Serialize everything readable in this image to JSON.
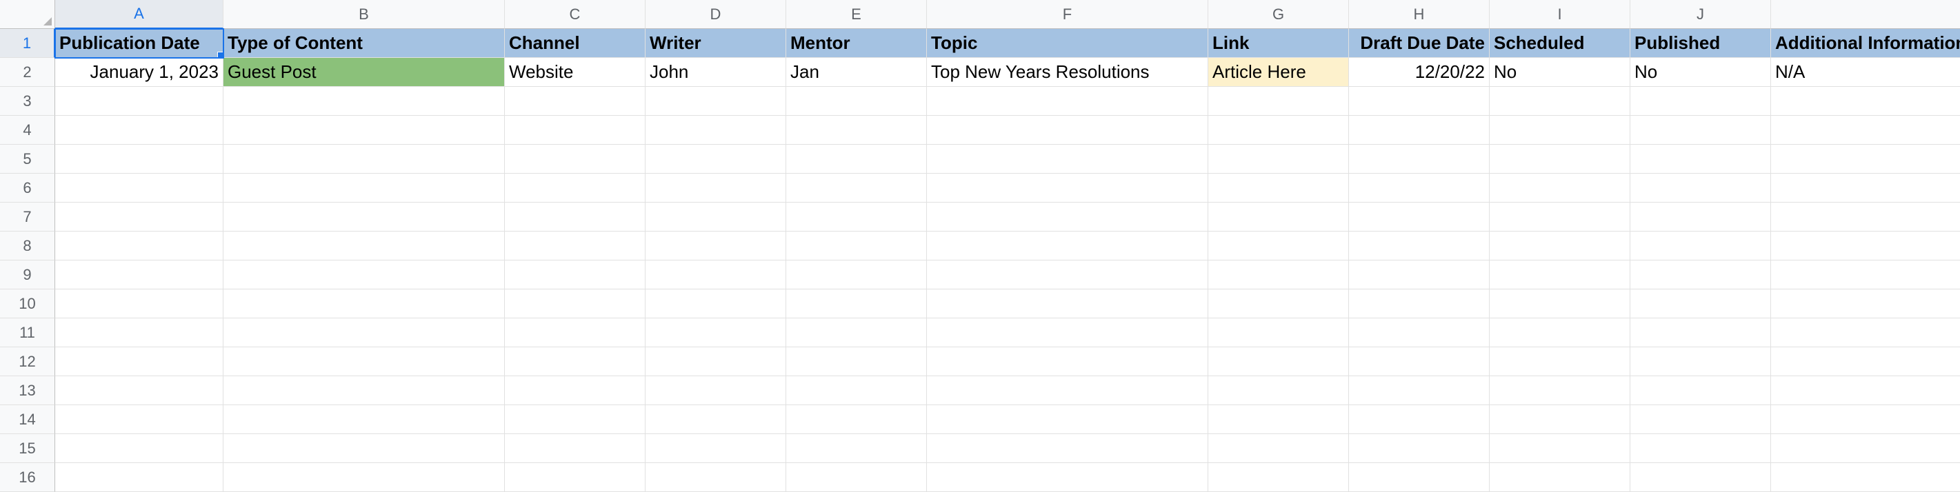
{
  "columns": [
    "A",
    "B",
    "C",
    "D",
    "E",
    "F",
    "G",
    "H",
    "I",
    "J",
    ""
  ],
  "rowCount": 16,
  "activeCell": {
    "col": 0,
    "row": 0
  },
  "headers": [
    "Publication Date",
    "Type of Content",
    "Channel",
    "Writer",
    "Mentor",
    "Topic",
    "Link",
    "Draft Due Date",
    "Scheduled",
    "Published",
    "Additional Information"
  ],
  "rows": [
    {
      "publication_date": "January 1, 2023",
      "type_of_content": "Guest Post",
      "channel": "Website",
      "writer": "John",
      "mentor": "Jan",
      "topic": "Top New Years Resolutions",
      "link": "Article Here",
      "draft_due_date": "12/20/22",
      "scheduled": "No",
      "published": "No",
      "additional_info": "N/A"
    }
  ],
  "colors": {
    "header_bg": "#a4c2e2",
    "type_bg": "#8bc17a",
    "link_bg": "#fdf1cc",
    "selection": "#1a73e8"
  }
}
